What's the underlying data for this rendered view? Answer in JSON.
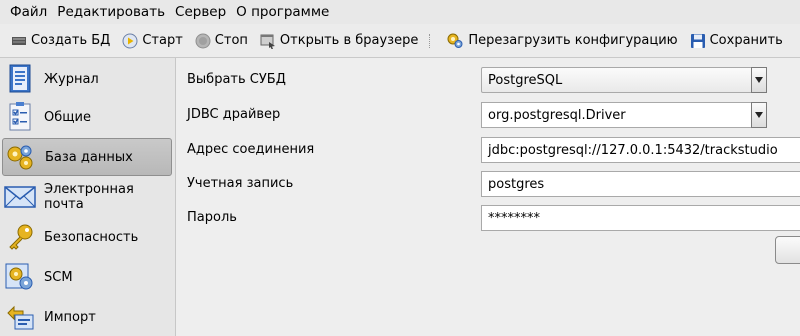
{
  "menu": [
    "Файл",
    "Редактировать",
    "Сервер",
    "О программе"
  ],
  "toolbar": {
    "create_db": "Создать БД",
    "start": "Старт",
    "stop": "Стоп",
    "open_browser": "Открыть в браузере",
    "reload_config": "Перезагрузить конфигурацию",
    "save": "Сохранить"
  },
  "sidebar": {
    "items": [
      {
        "label": "Журнал",
        "icon": "journal-icon"
      },
      {
        "label": "Общие",
        "icon": "checklist-icon"
      },
      {
        "label": "База данных",
        "icon": "database-gears-icon",
        "selected": true
      },
      {
        "label": "Электронная почта",
        "icon": "envelope-icon"
      },
      {
        "label": "Безопасность",
        "icon": "key-icon"
      },
      {
        "label": "SCM",
        "icon": "scm-gears-icon"
      },
      {
        "label": "Импорт",
        "icon": "import-icon"
      }
    ]
  },
  "form": {
    "dbms_label": "Выбрать СУБД",
    "dbms_value": "PostgreSQL",
    "jdbc_label": "JDBC драйвер",
    "jdbc_value": "org.postgresql.Driver",
    "url_label": "Адрес соединения",
    "url_value": "jdbc:postgresql://127.0.0.1:5432/trackstudio",
    "user_label": "Учетная запись",
    "user_value": "postgres",
    "password_label": "Пароль",
    "password_value": "********"
  },
  "colors": {
    "accent_blue": "#2a5db0",
    "gear_yellow": "#e6b422",
    "selected_bg": "#c3c3c3"
  }
}
